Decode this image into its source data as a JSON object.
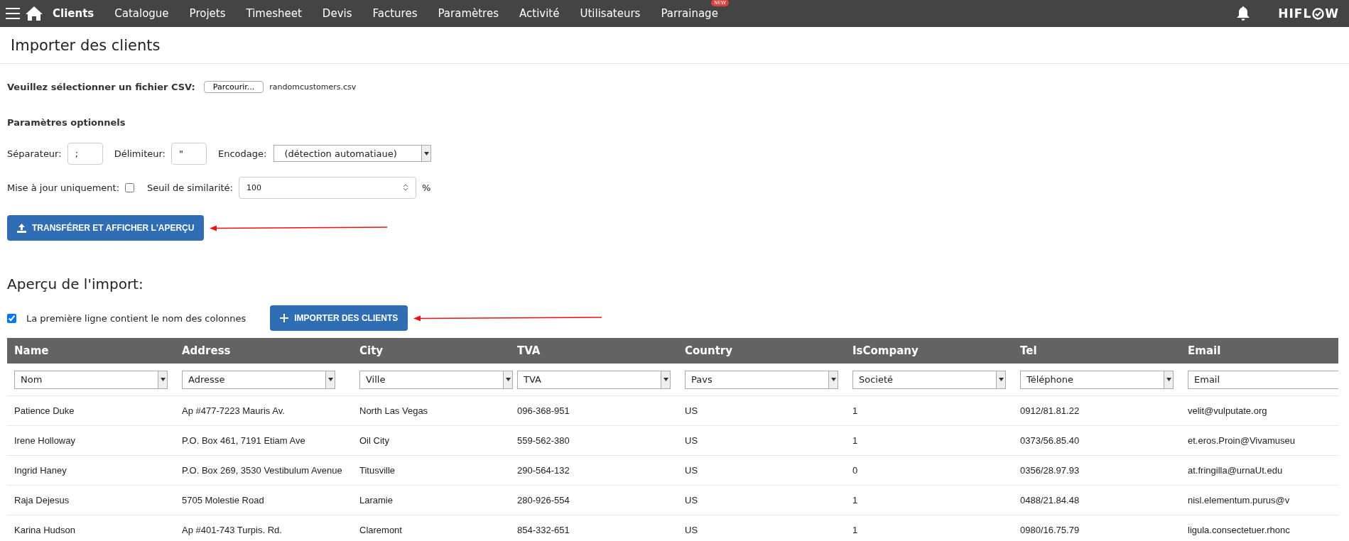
{
  "nav": {
    "items": [
      {
        "label": "Clients",
        "selected": true
      },
      {
        "label": "Catalogue",
        "selected": false
      },
      {
        "label": "Projets",
        "selected": false
      },
      {
        "label": "Timesheet",
        "selected": false
      },
      {
        "label": "Devis",
        "selected": false
      },
      {
        "label": "Factures",
        "selected": false
      },
      {
        "label": "Paramètres",
        "selected": false
      },
      {
        "label": "Activité",
        "selected": false
      },
      {
        "label": "Utilisateurs",
        "selected": false
      },
      {
        "label": "Parrainage",
        "selected": false,
        "badge": "NEW"
      }
    ],
    "logo": {
      "before": "HIFL",
      "after": "W"
    }
  },
  "page_title": "Importer des clients",
  "file": {
    "label": "Veuillez sélectionner un fichier CSV:",
    "button": "Parcourir...",
    "filename": "randomcustomers.csv"
  },
  "options_title": "Paramètres optionnels",
  "separator": {
    "label": "Séparateur:",
    "value": ";"
  },
  "delimiter": {
    "label": "Délimiteur:",
    "value": "\""
  },
  "encoding": {
    "label": "Encodage:",
    "value": "(détection automatiaue)"
  },
  "update_only": {
    "label": "Mise à jour uniquement:",
    "checked": false
  },
  "similarity": {
    "label": "Seuil de similarité:",
    "value": "100",
    "unit": "%"
  },
  "upload_button": "TRANSFÉRER ET AFFICHER L'APERÇU",
  "preview_title": "Aperçu de l'import:",
  "first_line": {
    "label": "La première ligne contient le nom des colonnes",
    "checked": true
  },
  "import_button": "IMPORTER DES CLIENTS",
  "table": {
    "columns": [
      {
        "header": "Name",
        "mapping": "Nom"
      },
      {
        "header": "Address",
        "mapping": "Adresse"
      },
      {
        "header": "City",
        "mapping": "Ville"
      },
      {
        "header": "TVA",
        "mapping": "TVA"
      },
      {
        "header": "Country",
        "mapping": "Pavs"
      },
      {
        "header": "IsCompany",
        "mapping": "Societé"
      },
      {
        "header": "Tel",
        "mapping": "Téléphone"
      },
      {
        "header": "Email",
        "mapping": "Email"
      }
    ],
    "rows": [
      [
        "Patience Duke",
        "Ap #477-7223 Mauris Av.",
        "North Las Vegas",
        "096-368-951",
        "US",
        "1",
        "0912/81.81.22",
        "velit@vulputate.org"
      ],
      [
        "Irene Holloway",
        "P.O. Box 461, 7191 Etiam Ave",
        "Oil City",
        "559-562-380",
        "US",
        "1",
        "0373/56.85.40",
        "et.eros.Proin@Vivamuseu"
      ],
      [
        "Ingrid Haney",
        "P.O. Box 269, 3530 Vestibulum Avenue",
        "Titusville",
        "290-564-132",
        "US",
        "0",
        "0356/28.97.93",
        "at.fringilla@urnaUt.edu"
      ],
      [
        "Raja Dejesus",
        "5705 Molestie Road",
        "Laramie",
        "280-926-554",
        "US",
        "1",
        "0488/21.84.48",
        "nisl.elementum.purus@v"
      ],
      [
        "Karina Hudson",
        "Ap #401-743 Turpis. Rd.",
        "Claremont",
        "854-332-651",
        "US",
        "1",
        "0980/16.75.79",
        "ligula.consectetuer.rhonc"
      ]
    ]
  }
}
